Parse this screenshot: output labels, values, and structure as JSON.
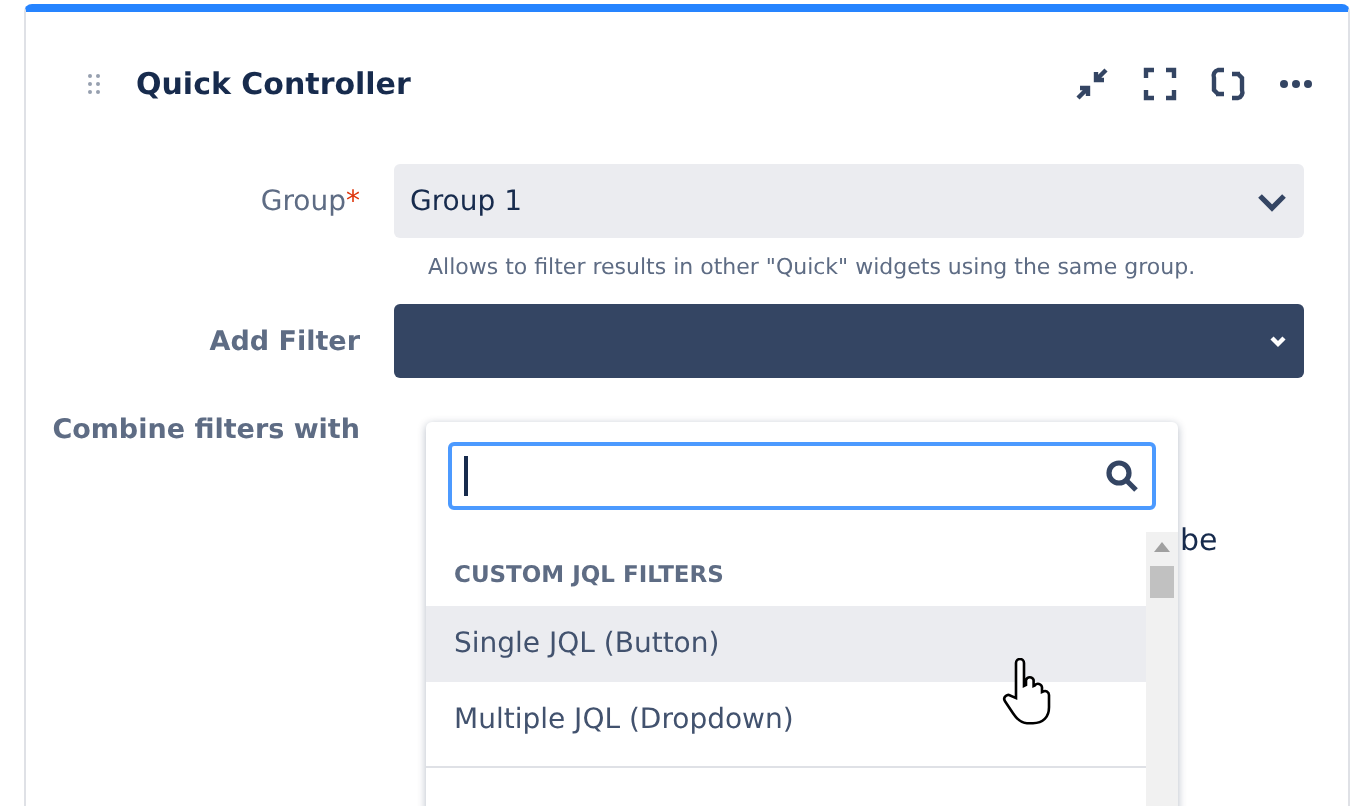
{
  "widget": {
    "title": "Quick Controller"
  },
  "form": {
    "group": {
      "label": "Group",
      "required_mark": "*",
      "value": "Group 1",
      "help": "Allows to filter results in other \"Quick\" widgets using the same group."
    },
    "add_filter": {
      "label": "Add Filter"
    },
    "combine": {
      "label": "Combine filters with",
      "partial_text": "be"
    }
  },
  "dropdown": {
    "section": "CUSTOM JQL FILTERS",
    "items": [
      {
        "label": "Single JQL (Button)",
        "selected": true
      },
      {
        "label": "Multiple JQL (Dropdown)",
        "selected": false
      }
    ]
  }
}
